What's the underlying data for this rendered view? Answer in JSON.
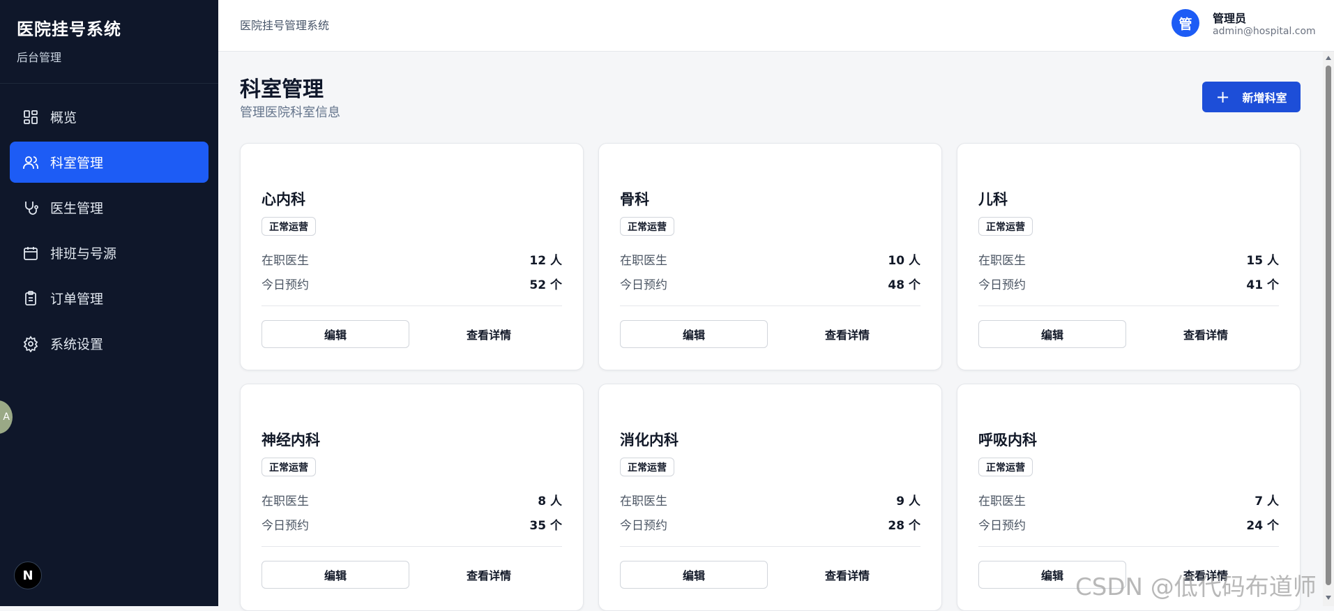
{
  "sidebar": {
    "title": "医院挂号系统",
    "subtitle": "后台管理",
    "items": [
      {
        "label": "概览",
        "icon": "dashboard-icon",
        "active": false
      },
      {
        "label": "科室管理",
        "icon": "users-icon",
        "active": true
      },
      {
        "label": "医生管理",
        "icon": "stethoscope-icon",
        "active": false
      },
      {
        "label": "排班与号源",
        "icon": "calendar-icon",
        "active": false
      },
      {
        "label": "订单管理",
        "icon": "clipboard-icon",
        "active": false
      },
      {
        "label": "系统设置",
        "icon": "gear-icon",
        "active": false
      }
    ],
    "corner_logo": "N",
    "edge_bubble": "A"
  },
  "header": {
    "breadcrumb": "医院挂号管理系统",
    "user": {
      "avatar": "管",
      "name": "管理员",
      "email": "admin@hospital.com"
    }
  },
  "main": {
    "title": "科室管理",
    "subtitle": "管理医院科室信息",
    "add_button": "新增科室",
    "departments": [
      {
        "name": "心内科",
        "status": "正常运营",
        "doctors_label": "在职医生",
        "doctors": "12 人",
        "appointments_label": "今日预约",
        "appointments": "52 个",
        "edit": "编辑",
        "detail": "查看详情"
      },
      {
        "name": "骨科",
        "status": "正常运营",
        "doctors_label": "在职医生",
        "doctors": "10 人",
        "appointments_label": "今日预约",
        "appointments": "48 个",
        "edit": "编辑",
        "detail": "查看详情"
      },
      {
        "name": "儿科",
        "status": "正常运营",
        "doctors_label": "在职医生",
        "doctors": "15 人",
        "appointments_label": "今日预约",
        "appointments": "41 个",
        "edit": "编辑",
        "detail": "查看详情"
      },
      {
        "name": "神经内科",
        "status": "正常运营",
        "doctors_label": "在职医生",
        "doctors": "8 人",
        "appointments_label": "今日预约",
        "appointments": "35 个",
        "edit": "编辑",
        "detail": "查看详情"
      },
      {
        "name": "消化内科",
        "status": "正常运营",
        "doctors_label": "在职医生",
        "doctors": "9 人",
        "appointments_label": "今日预约",
        "appointments": "28 个",
        "edit": "编辑",
        "detail": "查看详情"
      },
      {
        "name": "呼吸内科",
        "status": "正常运营",
        "doctors_label": "在职医生",
        "doctors": "7 人",
        "appointments_label": "今日预约",
        "appointments": "24 个",
        "edit": "编辑",
        "detail": "查看详情"
      }
    ]
  },
  "watermark": "CSDN @低代码布道师",
  "colors": {
    "sidebar_bg": "#0f172a",
    "accent": "#1d5cf5",
    "primary_button": "#1d4ed8"
  }
}
